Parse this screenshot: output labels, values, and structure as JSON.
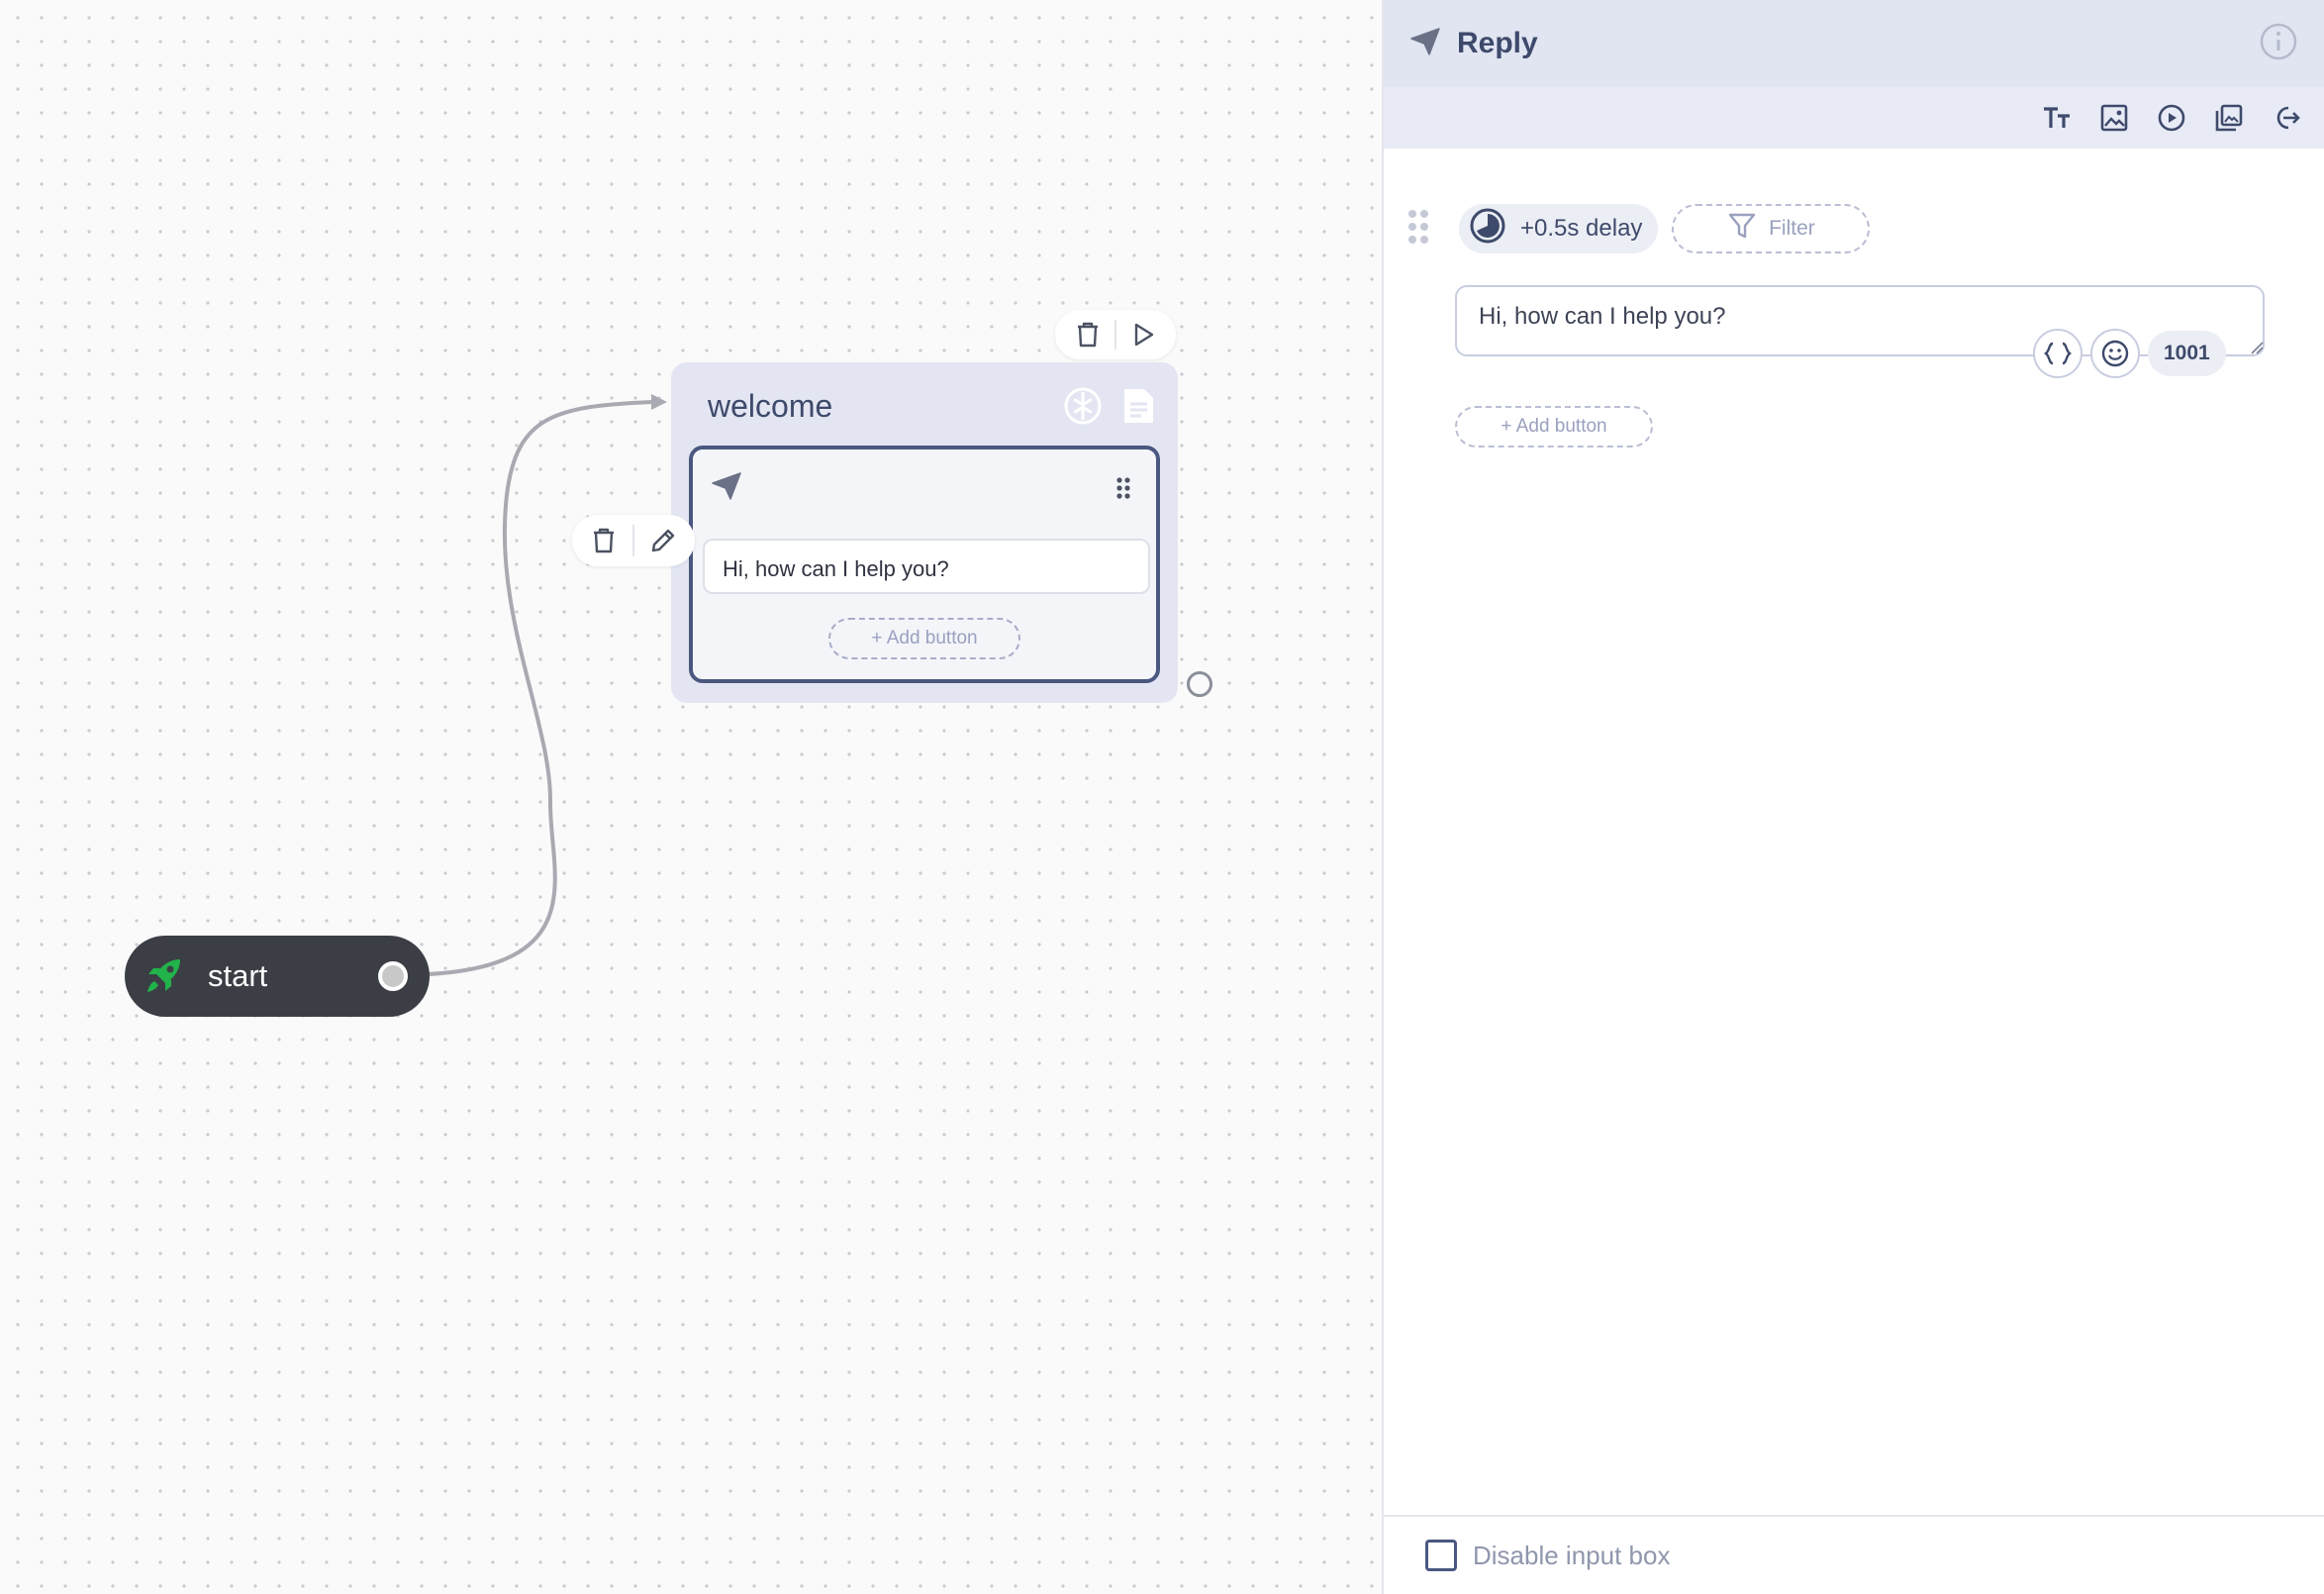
{
  "canvas": {
    "start_node": {
      "label": "start"
    },
    "block_node": {
      "title": "welcome",
      "message": "Hi, how can I help you?",
      "add_button_label": "+ Add button"
    }
  },
  "panel": {
    "title": "Reply",
    "delay_label": "+0.5s delay",
    "filter_label": "Filter",
    "textarea_value": "Hi, how can I help you?",
    "char_count": "1001",
    "add_button_label": "+ Add button",
    "footer_checkbox_label": "Disable input box",
    "tools": [
      "text-icon",
      "image-icon",
      "video-icon",
      "gallery-icon",
      "redirect-icon"
    ]
  },
  "colors": {
    "accent": "#4a5880",
    "header_bg": "#e1e5f2",
    "start_node_bg": "#3b3f45",
    "rocket": "#22b34a"
  }
}
